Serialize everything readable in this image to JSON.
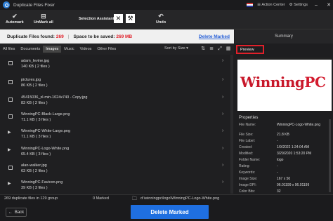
{
  "window": {
    "title": "Duplicate Files Fixer",
    "action_center": "Action Center",
    "settings": "Settings"
  },
  "toolbar": {
    "automark": "Automark",
    "unmark_all": "UnMark all",
    "selection_assistant": "Selection Assistant",
    "undo": "Undo"
  },
  "info": {
    "found_label": "Duplicate Files found:",
    "found_value": "269",
    "space_label": "Space to be saved:",
    "space_value": "269 MB",
    "delete_marked": "Delete Marked"
  },
  "tabs": [
    {
      "label": "All files"
    },
    {
      "label": "Documents"
    },
    {
      "label": "Images"
    },
    {
      "label": "Music"
    },
    {
      "label": "Videos"
    },
    {
      "label": "Other Files"
    }
  ],
  "sort": "Sort by Size",
  "rows": [
    {
      "name": "adam_levine.jpg",
      "size": "140 KB ( 2 files )"
    },
    {
      "name": "pictures.jpg",
      "size": "86 KB ( 2 files )"
    },
    {
      "name": "45415036_xl-min-1024x740 - Copy.jpg",
      "size": "83 KB ( 2 files )"
    },
    {
      "name": "WinningPC-Black-Large.png",
      "size": "71.1 KB ( 3 files )"
    },
    {
      "name": "WinningPC-White-Large.png",
      "size": "71.1 KB ( 3 files )"
    },
    {
      "name": "WinningPC-Logo-White.png",
      "size": "65.4 KB ( 3 files )"
    },
    {
      "name": "alan-walker.jpg",
      "size": "63 KB ( 2 files )"
    },
    {
      "name": "WinningPC-Favicon.png",
      "size": "39 KB ( 3 files )"
    }
  ],
  "summary": {
    "header": "Summary",
    "preview_tab": "Preview",
    "logo_main": "Winning",
    "logo_accent": "PC"
  },
  "properties": {
    "header": "Properties",
    "items": [
      {
        "label": "File Name:",
        "value": "WinningPC-Logo-White.png"
      },
      {
        "label": "File Size:",
        "value": "21.8 KB"
      },
      {
        "label": "File Label:",
        "value": "-"
      },
      {
        "label": "Created:",
        "value": "1/9/2022 1:24:04 AM"
      },
      {
        "label": "Modified:",
        "value": "3/29/2020 1:53:20 PM"
      },
      {
        "label": "Folder Name:",
        "value": "logo"
      },
      {
        "label": "Rating:",
        "value": "-"
      },
      {
        "label": "Keywords:",
        "value": "-"
      },
      {
        "label": "Image Size:",
        "value": "167 x 50"
      },
      {
        "label": "Image DPI:",
        "value": "96.01199 x 96.01199"
      },
      {
        "label": "Color Bits:",
        "value": "32"
      }
    ]
  },
  "status": {
    "files_in_groups": "269 duplicate files in 129 group",
    "marked": "0 Marked",
    "path": "d:\\winningpc\\logo\\WinningPC-Logo-White.png"
  },
  "bottom": {
    "back": "Back",
    "delete_marked": "Delete Marked"
  }
}
